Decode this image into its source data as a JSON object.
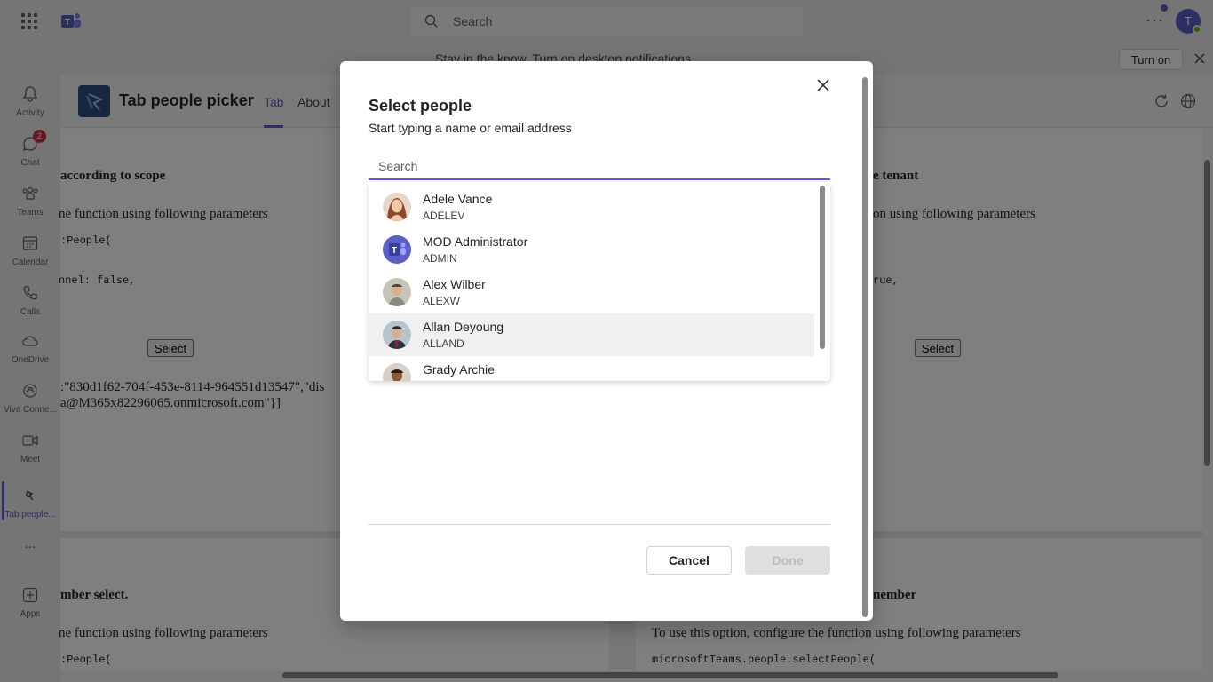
{
  "topbar": {
    "search_placeholder": "Search",
    "avatar_initial": "T",
    "more_label": "···"
  },
  "notification": {
    "message": "Stay in the know. Turn on desktop notifications.",
    "turn_on_label": "Turn on"
  },
  "rail": {
    "items": [
      {
        "label": "Activity",
        "icon": "bell-icon"
      },
      {
        "label": "Chat",
        "icon": "chat-icon",
        "badge": "2"
      },
      {
        "label": "Teams",
        "icon": "teams-icon"
      },
      {
        "label": "Calendar",
        "icon": "calendar-icon"
      },
      {
        "label": "Calls",
        "icon": "phone-icon"
      },
      {
        "label": "OneDrive",
        "icon": "cloud-icon"
      },
      {
        "label": "Viva Conne...",
        "icon": "viva-icon"
      },
      {
        "label": "Meet",
        "icon": "video-icon"
      },
      {
        "label": "Tab people...",
        "icon": "app-icon"
      },
      {
        "label": "...",
        "icon": "more-icon"
      },
      {
        "label": "Apps",
        "icon": "add-app-icon"
      }
    ]
  },
  "app": {
    "title": "Tab people picker",
    "tabs": [
      "Tab",
      "About"
    ]
  },
  "background": {
    "left_heading": "according to scope",
    "left_para": "ne function using following parameters",
    "left_code1": ":People(",
    "left_code2": "nnel: false,",
    "select_label": "Select",
    "left_result1": ":\"830d1f62-704f-453e-8114-964551d13547\",\"dis",
    "left_result2": "a@M365x82296065.onmicrosoft.com\"}]",
    "right_heading": "e tenant",
    "right_para": "on using following parameters",
    "right_code2": "rue,",
    "bottom_left_heading": "mber select.",
    "bottom_left_para": "ne function using following parameters",
    "bottom_left_code": ":People(",
    "bottom_right_heading": "nember",
    "bottom_right_para": "To use this option, configure the function using following parameters",
    "bottom_right_code": "microsoftTeams.people.selectPeople("
  },
  "dialog": {
    "title": "Select people",
    "subtitle": "Start typing a name or email address",
    "search_placeholder": "Search",
    "people": [
      {
        "name": "Adele Vance",
        "id": "ADELEV"
      },
      {
        "name": "MOD Administrator",
        "id": "ADMIN"
      },
      {
        "name": "Alex Wilber",
        "id": "ALEXW"
      },
      {
        "name": "Allan Deyoung",
        "id": "ALLAND"
      },
      {
        "name": "Grady Archie",
        "id": ""
      }
    ],
    "cancel_label": "Cancel",
    "done_label": "Done"
  },
  "colors": {
    "accent": "#5b5fc7",
    "badge": "#c4314b",
    "presence": "#6bb700"
  }
}
